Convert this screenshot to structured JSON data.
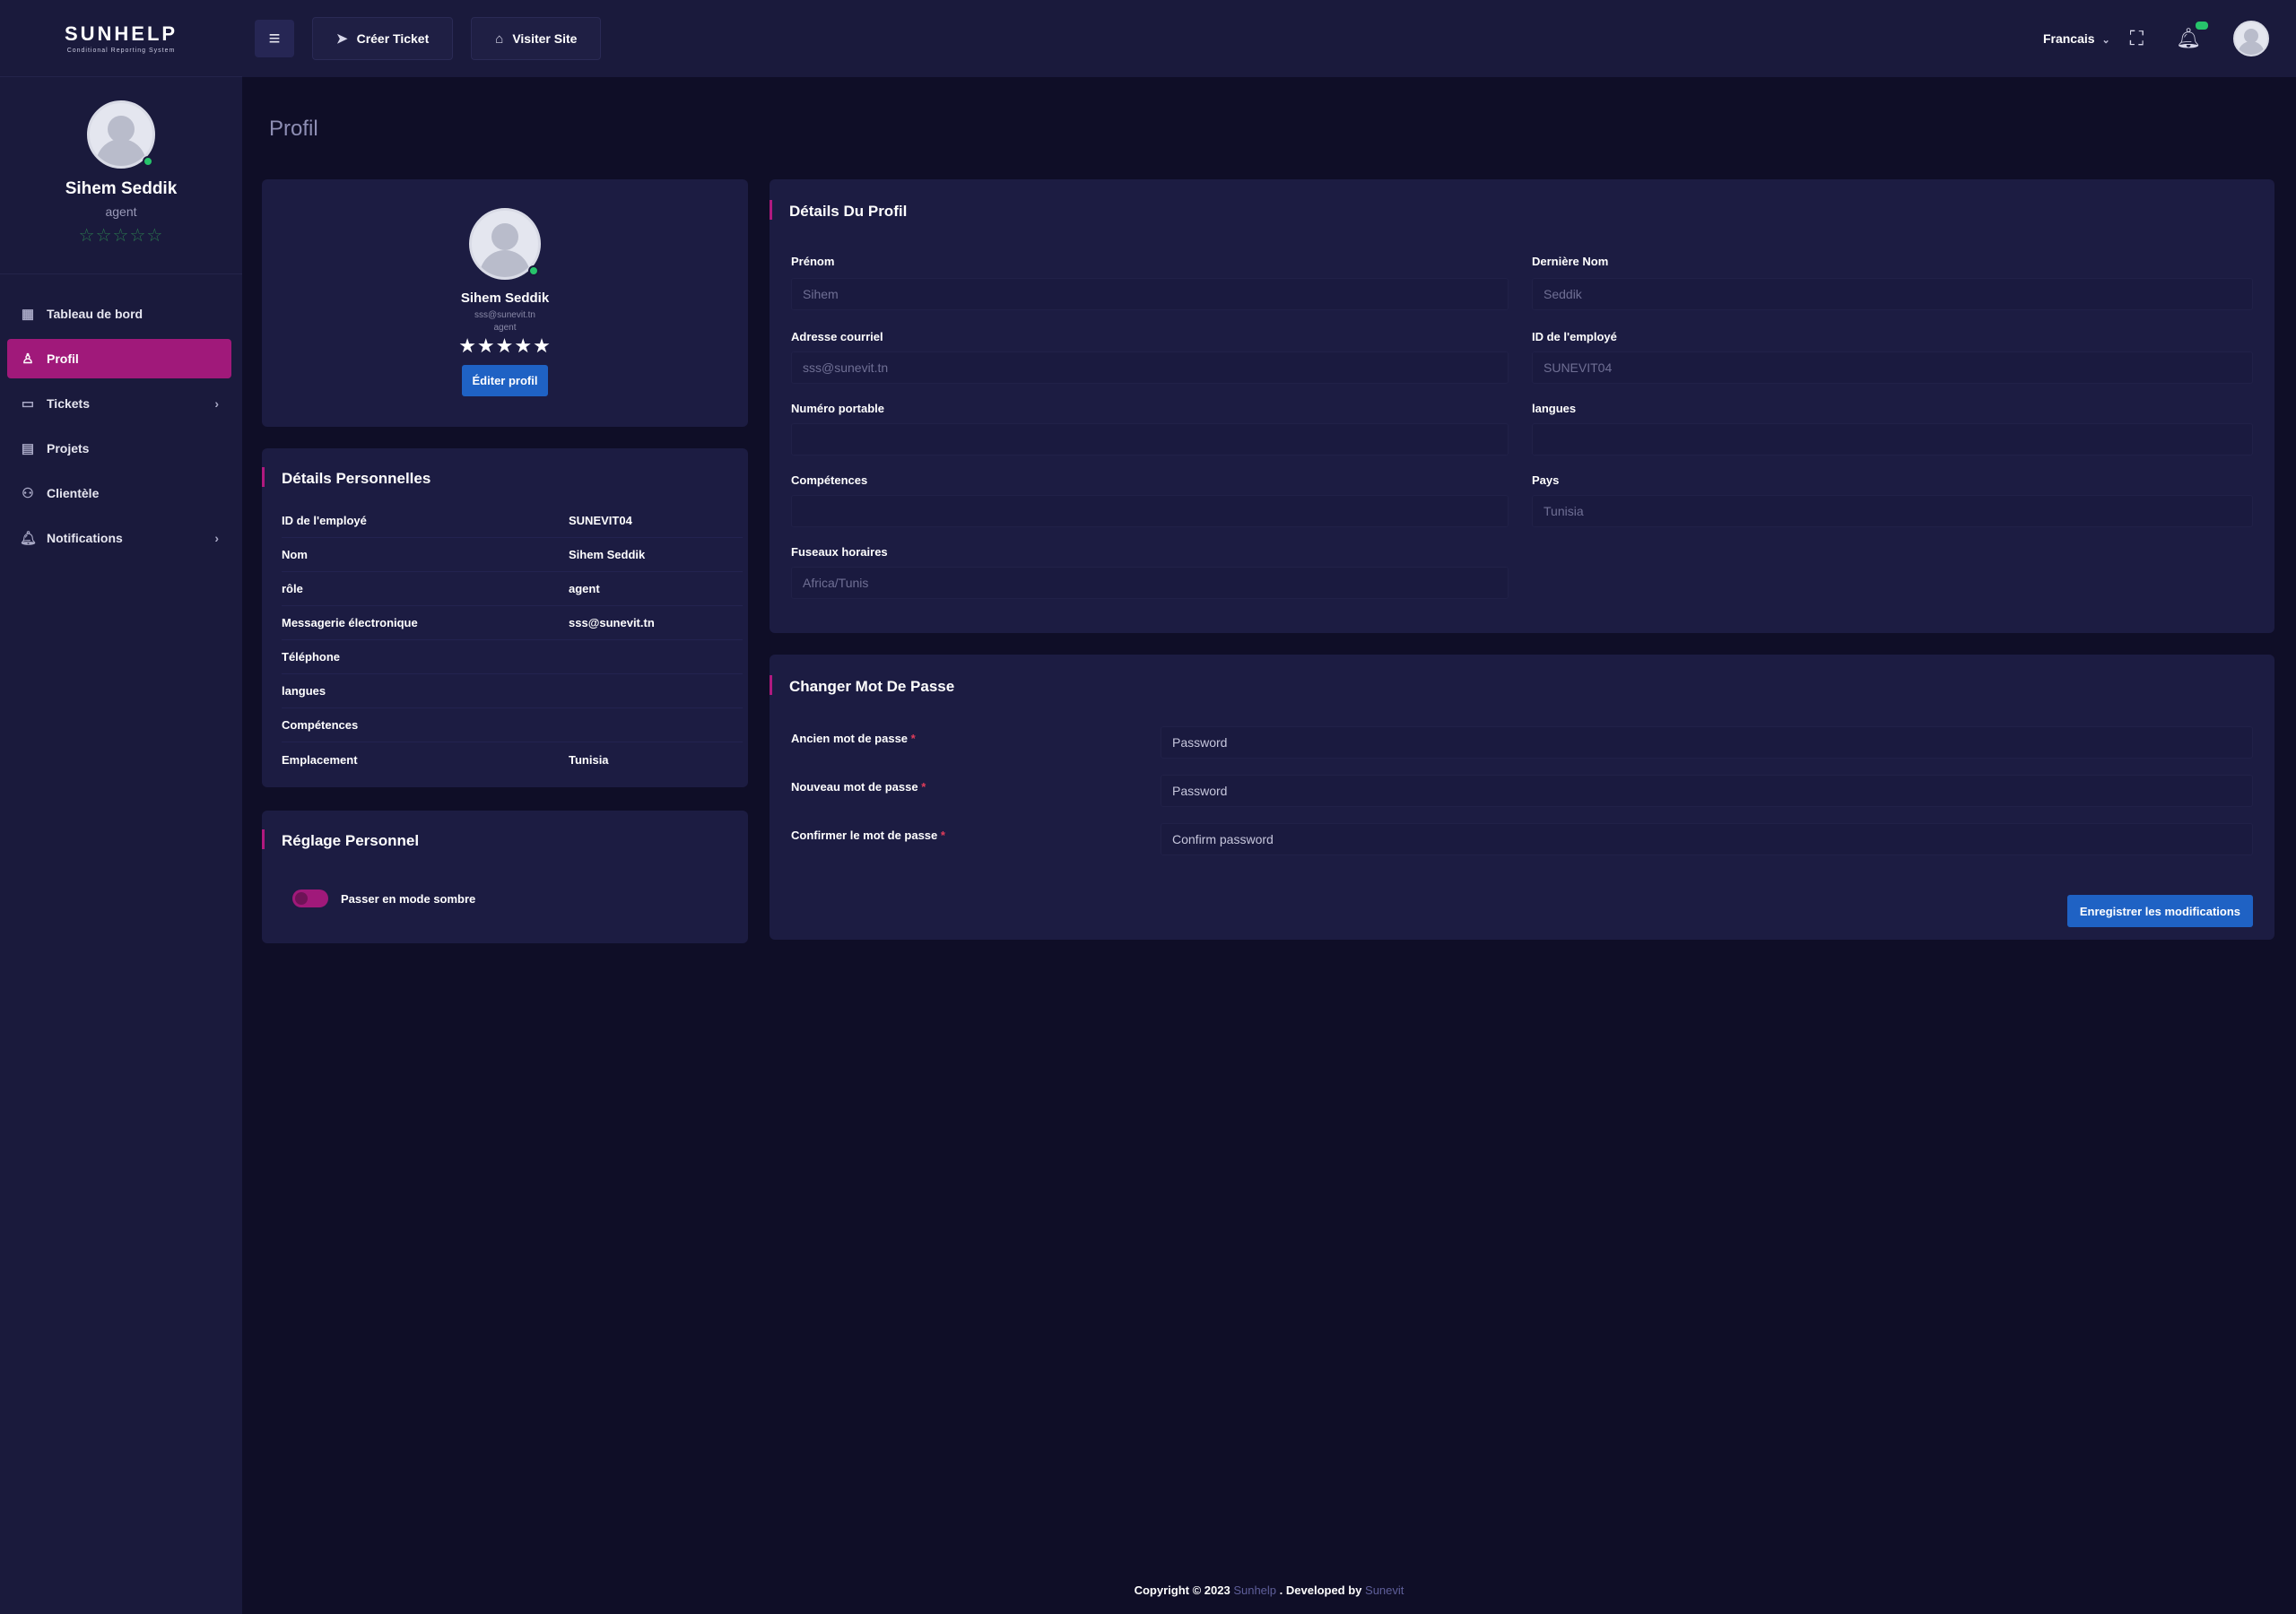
{
  "app": {
    "logo_text": "SUNHELP",
    "logo_sub": "Conditional Reporting System"
  },
  "sidebar": {
    "user_name": "Sihem Seddik",
    "user_role": "agent",
    "rating_stars": "☆☆☆☆☆",
    "items": [
      {
        "label": "Tableau de bord",
        "icon": "dashboard-icon"
      },
      {
        "label": "Profil",
        "icon": "user-icon"
      },
      {
        "label": "Tickets",
        "icon": "ticket-icon"
      },
      {
        "label": "Projets",
        "icon": "projects-icon"
      },
      {
        "label": "Clientèle",
        "icon": "users-icon"
      },
      {
        "label": "Notifications",
        "icon": "bell-icon"
      }
    ],
    "active_index": 1
  },
  "header": {
    "create_ticket": "Créer Ticket",
    "visit_site": "Visiter Site",
    "language": "Francais"
  },
  "page": {
    "title": "Profil"
  },
  "profile_card": {
    "name": "Sihem Seddik",
    "email": "sss@sunevit.tn",
    "role": "agent",
    "stars": "★★★★★",
    "edit_label": "Éditer profil"
  },
  "personal_details": {
    "title": "Détails Personnelles",
    "rows": [
      {
        "key": "ID de l'employé",
        "value": "SUNEVIT04"
      },
      {
        "key": "Nom",
        "value": "Sihem Seddik"
      },
      {
        "key": "rôle",
        "value": "agent"
      },
      {
        "key": "Messagerie électronique",
        "value": "sss@sunevit.tn"
      },
      {
        "key": "Téléphone",
        "value": ""
      },
      {
        "key": "langues",
        "value": ""
      },
      {
        "key": "Compétences",
        "value": ""
      },
      {
        "key": "Emplacement",
        "value": "Tunisia"
      }
    ]
  },
  "settings": {
    "title": "Réglage Personnel",
    "dark_mode_label": "Passer en mode sombre",
    "dark_mode_on": true
  },
  "profile_details": {
    "title": "Détails Du Profil",
    "first_name_label": "Prénom",
    "first_name_value": "Sihem",
    "last_name_label": "Dernière Nom",
    "last_name_value": "Seddik",
    "email_label": "Adresse courriel",
    "email_value": "sss@sunevit.tn",
    "employee_id_label": "ID de l'employé",
    "employee_id_value": "SUNEVIT04",
    "mobile_label": "Numéro portable",
    "mobile_value": "",
    "languages_label": "langues",
    "languages_value": "",
    "skills_label": "Compétences",
    "skills_value": "",
    "country_label": "Pays",
    "country_value": "Tunisia",
    "timezone_label": "Fuseaux horaires",
    "timezone_value": "Africa/Tunis"
  },
  "password": {
    "title": "Changer Mot De Passe",
    "old_label": "Ancien mot de passe",
    "old_placeholder": "Password",
    "new_label": "Nouveau mot de passe",
    "new_placeholder": "Password",
    "confirm_label": "Confirmer le mot de passe",
    "confirm_placeholder": "Confirm password",
    "required_mark": "*",
    "save_label": "Enregistrer les modifications"
  },
  "footer": {
    "prefix": "Copyright © 2023",
    "brand": "Sunhelp",
    "middle": ". Developed by",
    "developer": "Sunevit"
  },
  "colors": {
    "background": "#0f0e27",
    "panel": "#1c1c42",
    "sidebar": "#1a1a3c",
    "accent": "#a0197a",
    "primary_button": "#1f62c4",
    "online": "#27c46b"
  }
}
